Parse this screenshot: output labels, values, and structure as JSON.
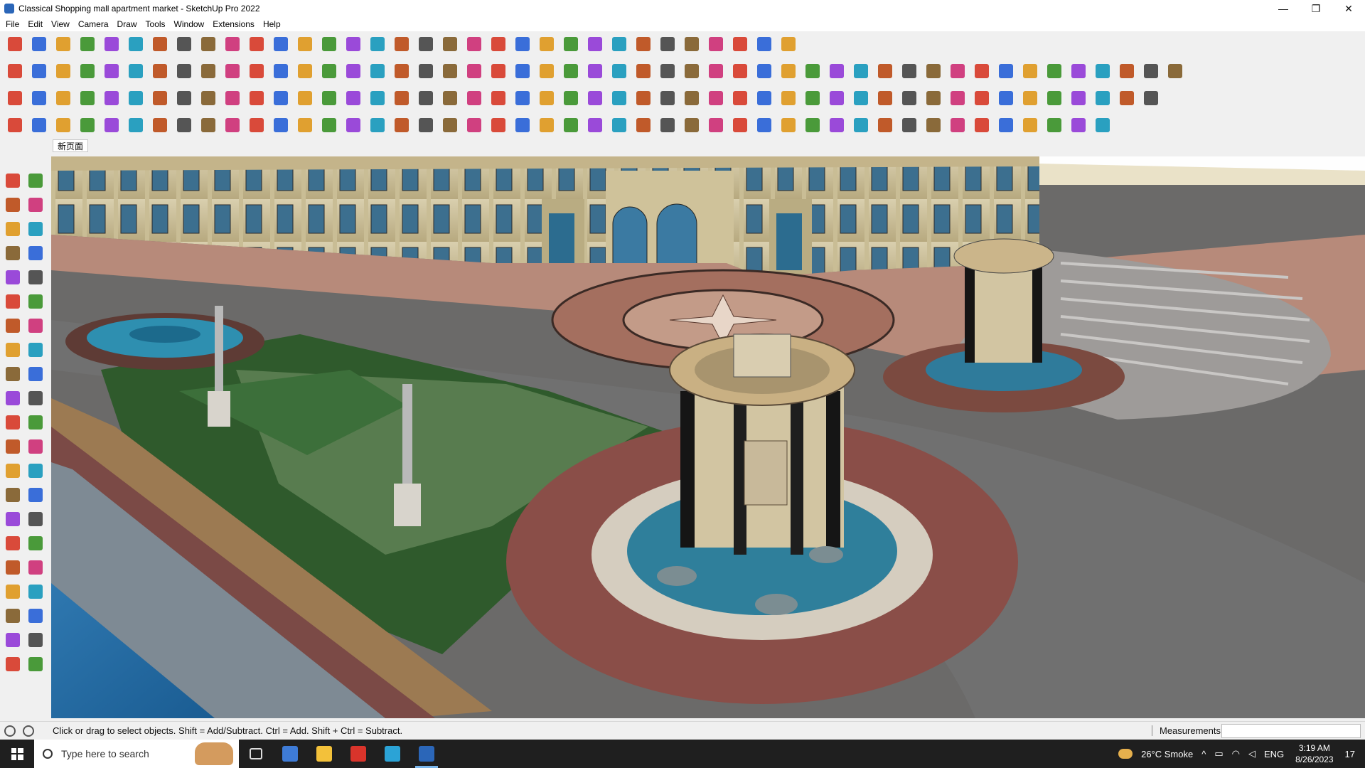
{
  "window": {
    "title": "Classical Shopping mall apartment market - SketchUp Pro 2022",
    "controls": {
      "minimize": "—",
      "restore": "❐",
      "close": "✕"
    }
  },
  "menu": [
    "File",
    "Edit",
    "View",
    "Camera",
    "Draw",
    "Tools",
    "Window",
    "Extensions",
    "Help"
  ],
  "scene_tab": "新页面",
  "toolbar_row1_icons": [
    "zoom-icon",
    "select-icon",
    "eraser-icon",
    "pencil-icon",
    "freehand-icon",
    "rectangle-icon",
    "push-pull-icon",
    "follow-me-icon",
    "move-icon",
    "rotate-icon",
    "scale-icon",
    "tape-icon",
    "text-icon",
    "paint-icon",
    "orbit-icon",
    "pan-icon",
    "zoom-window-icon",
    "zoom-extents-icon",
    "xray-icon",
    "back-edges-icon",
    "wireframe-icon",
    "hidden-line-icon",
    "shaded-icon",
    "warehouse-icon",
    "extension-icon",
    "layout-icon",
    "add-location-icon",
    "terrain-icon",
    "photo-texture-icon",
    "match-photo-icon",
    "undo-icon",
    "redo-icon",
    "ruby-icon"
  ],
  "toolbar_row2_icons": [
    "iso-view",
    "top-view",
    "front-view",
    "right-view",
    "back-view",
    "left-view",
    "bottom-view",
    "section-plane",
    "section-fill",
    "section-cut",
    "display-section",
    "sandbox-from-contours",
    "sandbox-from-scratch",
    "smoove",
    "stamp",
    "drape",
    "add-detail",
    "flip-edge",
    "solid-union",
    "solid-subtract",
    "solid-intersect",
    "solid-trim",
    "solid-split",
    "outer-shell",
    "style-shadow",
    "fog",
    "edge-style",
    "face-style",
    "profile",
    "soften",
    "smooth",
    "lock",
    "unlock",
    "group",
    "component",
    "explode",
    "intersect",
    "weld",
    "arc",
    "circle",
    "polygon",
    "ellipse",
    "parallelogram",
    "curve",
    "spiral",
    "spring",
    "lathe",
    "extrude",
    "array",
    "gradient",
    "texture",
    "fur",
    "mesh",
    "loft",
    "sweep",
    "bend"
  ],
  "toolbar_row3_icons": [
    "plugin-1",
    "plugin-2",
    "plugin-3",
    "plugin-4",
    "plugin-5",
    "plugin-6",
    "plugin-7",
    "plugin-8",
    "plugin-9",
    "plugin-10",
    "plugin-11",
    "plugin-12",
    "plugin-13",
    "plugin-14",
    "plugin-15",
    "plugin-16",
    "plugin-17",
    "plugin-18",
    "plugin-19",
    "plugin-20",
    "plugin-21",
    "plugin-22",
    "plugin-23",
    "plugin-24",
    "plugin-25",
    "plugin-26",
    "plugin-27",
    "plugin-28",
    "plugin-29",
    "plugin-30",
    "plugin-31",
    "plugin-32",
    "plugin-33",
    "plugin-34",
    "plugin-35",
    "plugin-36",
    "plugin-37",
    "plugin-38",
    "plugin-39",
    "plugin-40",
    "plugin-41",
    "plugin-42",
    "plugin-43",
    "plugin-44",
    "plugin-45",
    "plugin-46",
    "plugin-47",
    "plugin-48"
  ],
  "toolbar_row4_icons": [
    "stair-1",
    "stair-2",
    "stair-3",
    "stair-4",
    "stair-5",
    "stair-6",
    "stair-7",
    "stair-8",
    "stair-9",
    "stair-10",
    "stair-11",
    "stair-12",
    "stair-13",
    "stair-14",
    "stair-15",
    "stair-16",
    "stair-17",
    "stair-18",
    "stair-19",
    "stair-20",
    "stair-21",
    "stair-22",
    "stair-23",
    "stair-24",
    "stair-25",
    "stair-26",
    "stair-27",
    "stair-28",
    "stair-29",
    "stair-30",
    "stair-31",
    "stair-32",
    "stair-33",
    "stair-34",
    "stair-35",
    "stair-36",
    "stair-37",
    "stair-38",
    "stair-39",
    "stair-40",
    "stair-41",
    "stair-42",
    "stair-43",
    "stair-44",
    "stair-45",
    "stair-46"
  ],
  "left_tools": [
    "select",
    "orbit",
    "paint-bucket",
    "eraser",
    "sandbox",
    "tape-measure",
    "line",
    "freehand",
    "rectangle",
    "rotated-rect",
    "circle",
    "polygon",
    "arc",
    "pie",
    "2pt-arc",
    "3pt-arc",
    "move",
    "push-pull",
    "rotate",
    "follow-me",
    "scale",
    "offset",
    "tape",
    "text",
    "axes",
    "3d-text",
    "dimension",
    "protractor",
    "orbit-2",
    "pan",
    "zoom",
    "zoom-window",
    "zoom-extents",
    "previous",
    "walk",
    "look-around",
    "position-camera",
    "section-plane",
    "xray",
    "back-edges",
    "wireframe",
    "hidden-line"
  ],
  "status": {
    "hint": "Click or drag to select objects. Shift = Add/Subtract. Ctrl = Add. Shift + Ctrl = Subtract.",
    "measurements_label": "Measurements",
    "measurements_value": ""
  },
  "taskbar": {
    "search_placeholder": "Type here to search",
    "weather": "26°C  Smoke",
    "language": "ENG",
    "time": "3:19 AM",
    "date": "8/26/2023",
    "notifications": "17"
  },
  "colors": {
    "accent": "#2b66b8",
    "viewport_sky": "#fefefe"
  }
}
